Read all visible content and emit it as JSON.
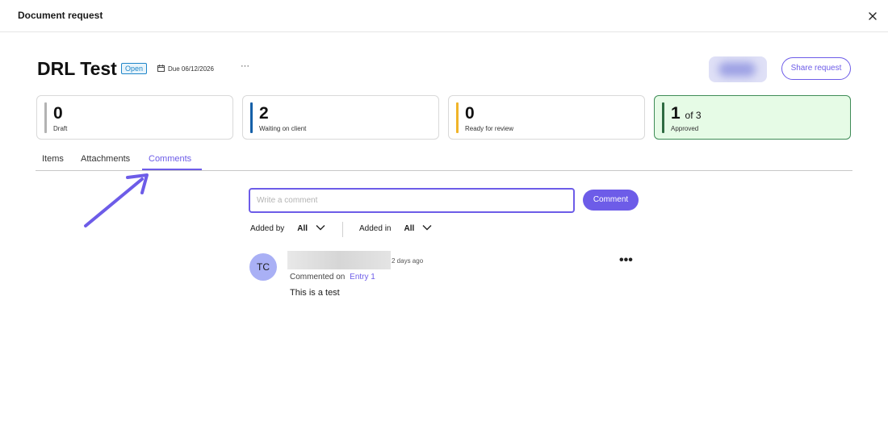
{
  "modal": {
    "title": "Document request",
    "close_icon": "close-icon"
  },
  "request": {
    "title": "DRL Test",
    "status": "Open",
    "due": "Due 06/12/2026",
    "more": "···"
  },
  "actions": {
    "share_label": "Share request"
  },
  "stats": [
    {
      "value": "0",
      "label": "Draft",
      "color": "#b3b3b3"
    },
    {
      "value": "2",
      "label": "Waiting on client",
      "color": "#1560a8"
    },
    {
      "value": "0",
      "label": "Ready for review",
      "color": "#f0b429"
    },
    {
      "value": "1",
      "of": "of 3",
      "label": "Approved",
      "color": "#2e6b41"
    }
  ],
  "tabs": [
    {
      "label": "Items",
      "active": false
    },
    {
      "label": "Attachments",
      "active": false
    },
    {
      "label": "Comments",
      "active": true
    }
  ],
  "composer": {
    "placeholder": "Write a comment",
    "button_label": "Comment"
  },
  "filters": {
    "added_by": {
      "label": "Added by",
      "value": "All"
    },
    "added_in": {
      "label": "Added in",
      "value": "All"
    }
  },
  "comments": [
    {
      "initials": "TC",
      "time": "2 days ago",
      "meta_prefix": "Commented on",
      "entry_link": "Entry 1",
      "text": "This is a test",
      "more": "•••"
    }
  ],
  "colors": {
    "accent": "#6d5ce8",
    "approved_bg": "#e6fbe6",
    "badge": "#1f86c9"
  }
}
